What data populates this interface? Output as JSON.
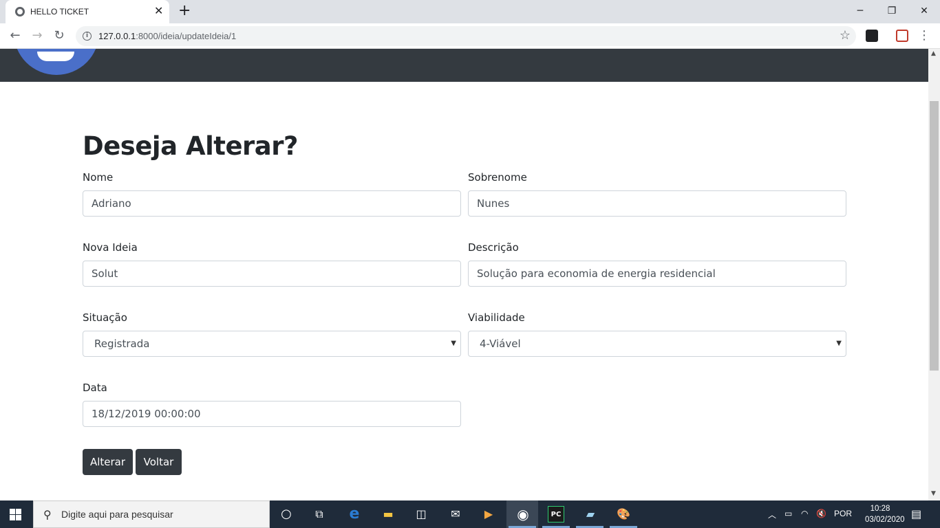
{
  "browser": {
    "tab_title": "HELLO TICKET",
    "url_host": "127.0.0.1",
    "url_path": ":8000/ideia/updateIdeia/1"
  },
  "page": {
    "heading": "Deseja Alterar?",
    "fields": {
      "nome": {
        "label": "Nome",
        "value": "Adriano"
      },
      "sobrenome": {
        "label": "Sobrenome",
        "value": "Nunes"
      },
      "nova_ideia": {
        "label": "Nova Ideia",
        "value": "Solut"
      },
      "descricao": {
        "label": "Descrição",
        "value": "Solução para economia de energia residencial"
      },
      "situacao": {
        "label": "Situação",
        "value": "Registrada"
      },
      "viabilidade": {
        "label": "Viabilidade",
        "value": "4-Viável"
      },
      "data": {
        "label": "Data",
        "value": "18/12/2019 00:00:00"
      }
    },
    "buttons": {
      "alterar": "Alterar",
      "voltar": "Voltar"
    }
  },
  "taskbar": {
    "search_placeholder": "Digite aqui para pesquisar",
    "language": "POR",
    "time": "10:28",
    "date": "03/02/2020"
  }
}
